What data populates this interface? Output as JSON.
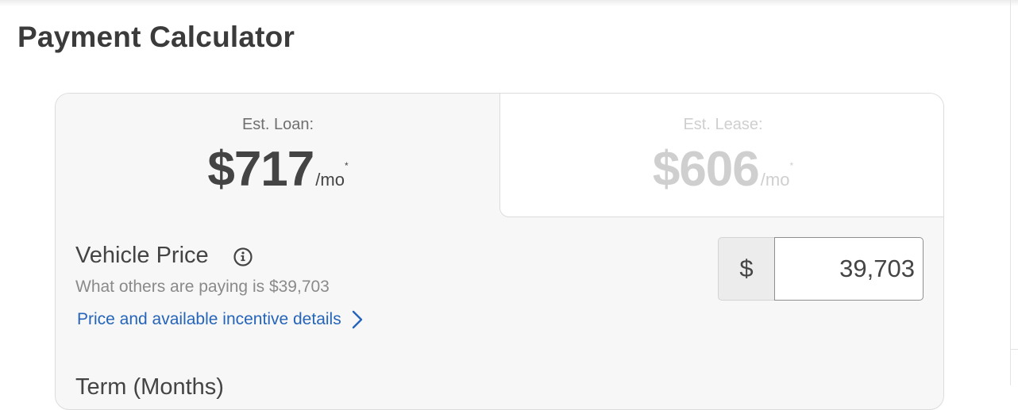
{
  "page": {
    "title": "Payment Calculator"
  },
  "tabs": {
    "loan": {
      "label": "Est. Loan:",
      "amount": "$717",
      "unit": "/mo",
      "footnote": "*",
      "active": true
    },
    "lease": {
      "label": "Est. Lease:",
      "amount": "$606",
      "unit": "/mo",
      "footnote": "*",
      "active": false
    }
  },
  "vehicle_price": {
    "label": "Vehicle Price",
    "subtext": "What others are paying is $39,703",
    "link_text": "Price and available incentive details",
    "currency_symbol": "$",
    "value": "39,703"
  },
  "term": {
    "label": "Term (Months)"
  },
  "icons": {
    "info": "info-circle-icon",
    "chevron": "chevron-right-icon"
  },
  "colors": {
    "link": "#2564b8",
    "active_text": "#444444",
    "inactive_text": "#cfcfcf"
  }
}
